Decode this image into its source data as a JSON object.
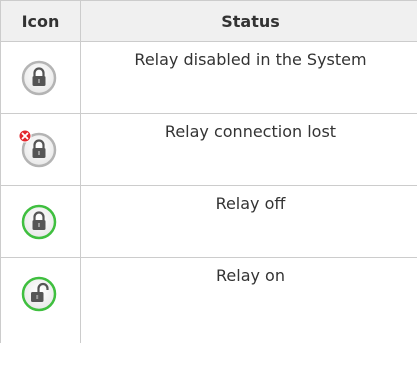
{
  "table": {
    "headers": {
      "icon": "Icon",
      "status": "Status"
    },
    "rows": [
      {
        "icon": "lock-closed-gray-icon",
        "status": "Relay disabled in the System"
      },
      {
        "icon": "lock-closed-error-icon",
        "status": "Relay connection lost"
      },
      {
        "icon": "lock-closed-green-icon",
        "status": "Relay off"
      },
      {
        "icon": "lock-open-green-icon",
        "status": "Relay on"
      }
    ]
  },
  "colors": {
    "header_background": "#f0f0f0",
    "border": "#cccccc",
    "text": "#333333",
    "ring_gray": "#b4b4b4",
    "ring_green": "#3fbf3f",
    "error_badge": "#e2252b",
    "lock_body": "#555555"
  }
}
